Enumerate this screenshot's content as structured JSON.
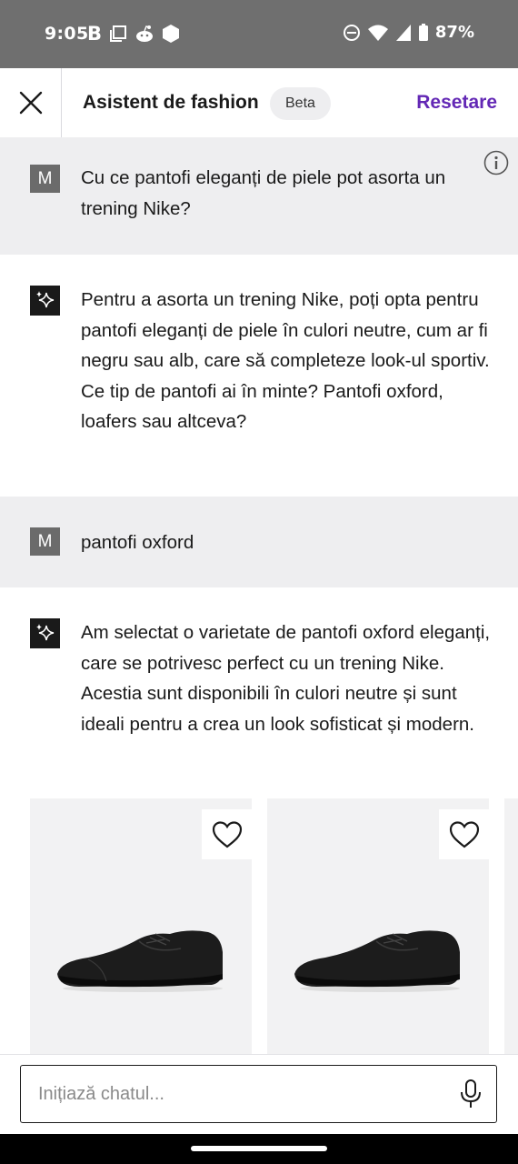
{
  "status_bar": {
    "time": "9:05",
    "b_label": "B",
    "battery": "87%"
  },
  "header": {
    "title": "Asistent de fashion",
    "badge": "Beta",
    "reset": "Resetare"
  },
  "conversation": [
    {
      "role": "user",
      "avatar": "M",
      "text": "Cu ce pantofi eleganți de piele pot asorta un trening Nike?"
    },
    {
      "role": "assistant",
      "avatar_icon": "sparkles-icon",
      "text": "Pentru a asorta un trening Nike, poți opta pentru pantofi eleganți de piele în culori neutre, cum ar fi negru sau alb, care să completeze look-ul sportiv. Ce tip de pantofi ai în minte? Pantofi oxford, loafers sau altceva?"
    },
    {
      "role": "user",
      "avatar": "M",
      "text": "pantofi oxford"
    },
    {
      "role": "assistant",
      "avatar_icon": "sparkles-icon",
      "text": "Am selectat o varietate de pantofi oxford eleganți, care se potrivesc perfect cu un trening Nike. Acestia sunt disponibili în culori neutre și sunt ideali pentru a crea un look sofisticat și modern."
    }
  ],
  "products": [
    {
      "image": "black-oxford-shoe",
      "favorite_icon": "heart-icon"
    },
    {
      "image": "black-oxford-shoe",
      "favorite_icon": "heart-icon"
    }
  ],
  "input": {
    "placeholder": "Inițiază chatul...",
    "value": ""
  },
  "colors": {
    "accent": "#6328b5",
    "status_bar": "#6f6f6f",
    "user_bg": "#eeeef0",
    "avatar_user": "#6b6b6b",
    "avatar_ai": "#1a1a1a"
  }
}
